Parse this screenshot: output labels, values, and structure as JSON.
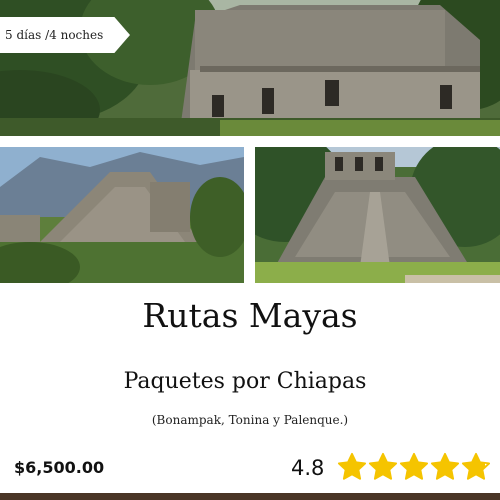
{
  "badge": {
    "duration": "5 días /4 noches"
  },
  "card": {
    "title": "Rutas Mayas",
    "subtitle": "Paquetes por Chiapas",
    "places": "(Bonampak, Tonina y Palenque.)",
    "price": "$6,500.00",
    "rating": "4.8",
    "rating_stars": 4.8,
    "rating_max": 5
  },
  "colors": {
    "star": "#f5c400",
    "bottom_bar": "#4a3526"
  }
}
